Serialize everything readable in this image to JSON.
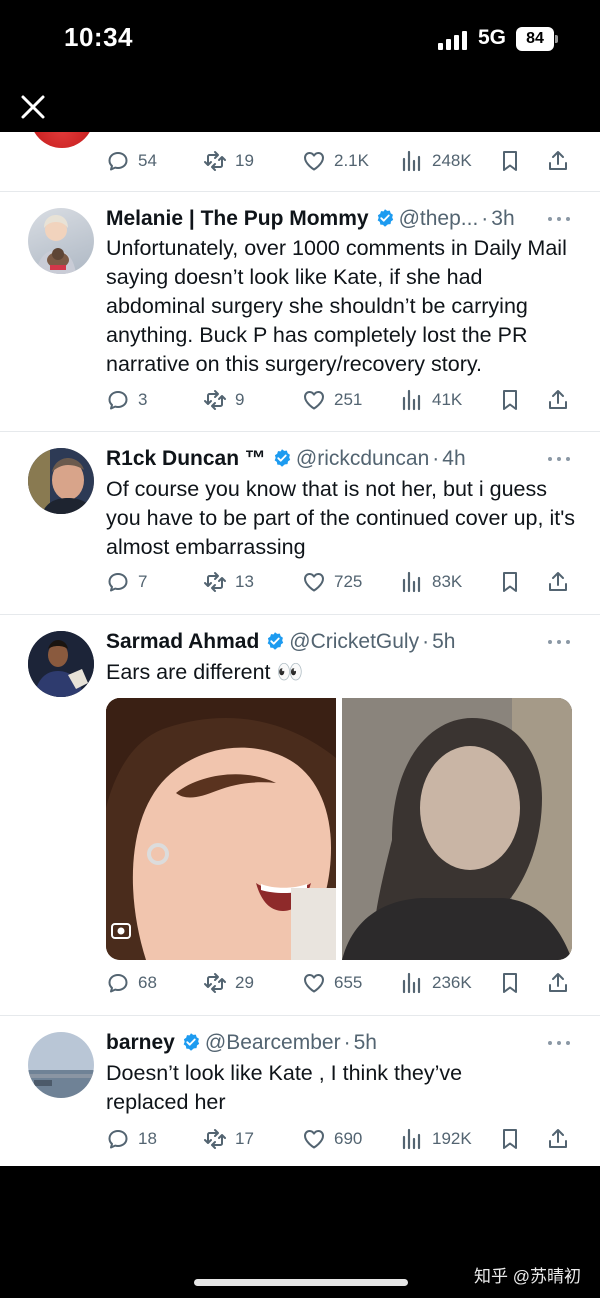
{
  "status_bar": {
    "time": "10:34",
    "network": "5G",
    "battery": "84"
  },
  "top_fragment": {
    "replies": "54",
    "reposts": "19",
    "likes": "2.1K",
    "views": "248K"
  },
  "tweets": [
    {
      "name": "Melanie | The Pup Mommy",
      "handle": "@thep...",
      "time": "3h",
      "text": "Unfortunately, over 1000 comments in Daily Mail saying doesn’t look like Kate, if she had abdominal surgery she shouldn’t be carrying anything. Buck P has completely lost the PR narrative on this surgery/recovery story.",
      "replies": "3",
      "reposts": "9",
      "likes": "251",
      "views": "41K"
    },
    {
      "name": "R1ck Duncan ™",
      "handle": "@rickcduncan",
      "time": "4h",
      "text": "Of course you know that is not her, but i guess you have to be part of the continued cover up, it's almost embarrassing",
      "replies": "7",
      "reposts": "13",
      "likes": "725",
      "views": "83K"
    },
    {
      "name": "Sarmad Ahmad",
      "handle": "@CricketGuly",
      "time": "5h",
      "text": "Ears are different 👀",
      "replies": "68",
      "reposts": "29",
      "likes": "655",
      "views": "236K"
    },
    {
      "name": "barney",
      "handle": "@Bearcember",
      "time": "5h",
      "text": "Doesn’t look like Kate , I think they’ve replaced her",
      "replies": "18",
      "reposts": "17",
      "likes": "690",
      "views": "192K"
    }
  ],
  "watermark": "知乎 @苏晴初",
  "colors": {
    "verified": "#1d9bf0",
    "secondary_text": "#536471",
    "divider": "#e6e9ec"
  },
  "icons": [
    "close-icon",
    "reply-icon",
    "repost-icon",
    "like-icon",
    "views-icon",
    "bookmark-icon",
    "share-icon",
    "verified-badge-icon",
    "more-options-icon"
  ]
}
